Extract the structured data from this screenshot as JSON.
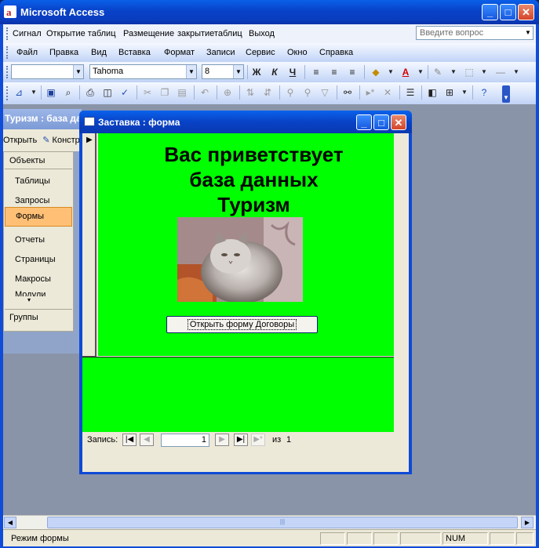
{
  "app": {
    "title": "Microsoft Access"
  },
  "custom_menu": [
    "Сигнал",
    "Открытие таблиц",
    "Размещение",
    "закрытиетаблиц",
    "Выход"
  ],
  "ask_box": {
    "placeholder": "Введите вопрос"
  },
  "main_menu": [
    "Файл",
    "Правка",
    "Вид",
    "Вставка",
    "Формат",
    "Записи",
    "Сервис",
    "Окно",
    "Справка"
  ],
  "format_toolbar": {
    "object": "",
    "font": "Tahoma",
    "size": "8",
    "bold": "Ж",
    "italic": "К",
    "underline": "Ч"
  },
  "db_window": {
    "title": "Туризм : база данных",
    "open_label": "Открыть",
    "design_label": "Конструктор",
    "objects_header": "Объекты",
    "items": [
      "Таблицы",
      "Запросы",
      "Формы",
      "Отчеты",
      "Страницы",
      "Макросы",
      "Модули"
    ],
    "selected": "Формы",
    "groups_header": "Группы"
  },
  "form_window": {
    "title": "Заставка : форма",
    "greeting": [
      "Вас приветствует",
      "база данных",
      "Туризм"
    ],
    "open_button": "Открыть форму Договоры",
    "green": "#00ff00"
  },
  "nav": {
    "label": "Запись:",
    "current": "1",
    "of_label": "из",
    "total": "1"
  },
  "status": {
    "mode": "Режим формы",
    "num": "NUM"
  },
  "colors": {
    "titlebar": "#0842c8",
    "form_background": "#00ff00",
    "selected_item": "#ffc076"
  }
}
